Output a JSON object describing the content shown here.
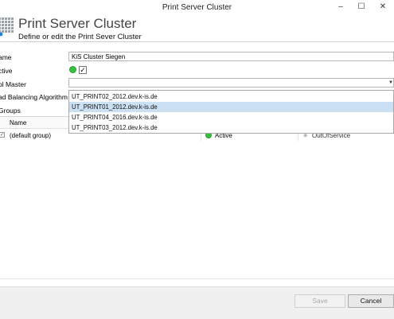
{
  "window": {
    "title": "Print Server Cluster",
    "minimize_glyph": "–",
    "maximize_glyph": "☐",
    "close_glyph": "✕"
  },
  "header": {
    "title": "Print Server Cluster",
    "subtitle": "Define or edit the Print Sever Cluster",
    "icon": "server-grid-icon"
  },
  "form": {
    "name_label": "ame",
    "name_value": "KiS Cluster Siegen",
    "active_label": "ctive",
    "active_checked_glyph": "✓",
    "pool_master_label": "ol Master",
    "pool_master_value": "",
    "load_balancing_label": "ad Balancing Algorithm"
  },
  "dropdown": {
    "items": [
      {
        "label": "UT_PRINT02_2012.dev.k-is.de",
        "selected": false
      },
      {
        "label": "UT_PRINT01_2012.dev.k-is.de",
        "selected": true
      },
      {
        "label": "UT_PRINT04_2016.dev.k-is.de",
        "selected": false
      },
      {
        "label": "UT_PRINT03_2012.dev.k-is.de",
        "selected": false
      }
    ]
  },
  "groups": {
    "header": "Groups",
    "columns": [
      "Name"
    ],
    "rows": [
      {
        "checked_glyph": "✓",
        "name": "(default group)",
        "status": "Active",
        "service": "OutOfService"
      }
    ]
  },
  "footer": {
    "save_label": "Save",
    "cancel_label": "Cancel"
  },
  "colors": {
    "active_green": "#35c13f",
    "selection_blue": "#cbe1f3"
  }
}
